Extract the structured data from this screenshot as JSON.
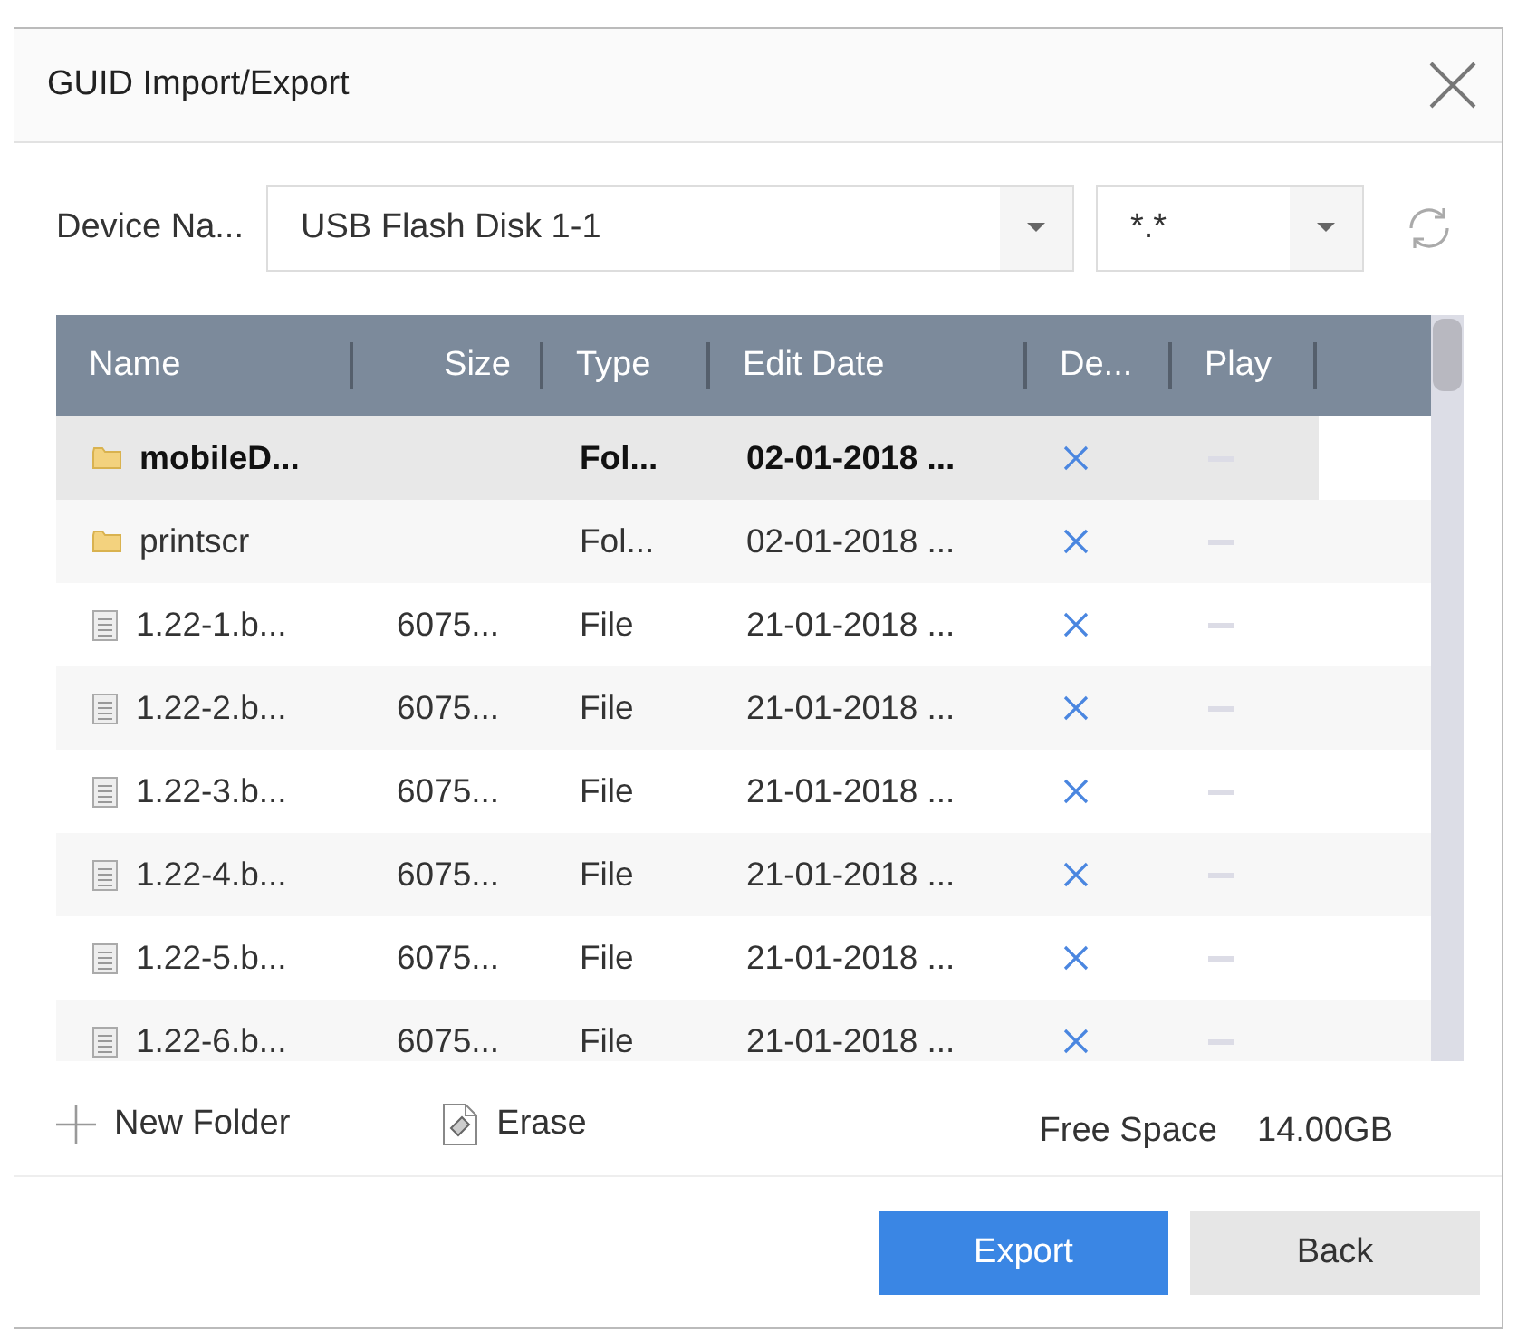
{
  "window": {
    "title": "GUID Import/Export"
  },
  "device": {
    "label": "Device Na...",
    "value": "USB Flash Disk 1-1",
    "filter": "*.*"
  },
  "table": {
    "columns": [
      "Name",
      "Size",
      "Type",
      "Edit Date",
      "De...",
      "Play"
    ],
    "rows": [
      {
        "kind": "folder",
        "name": "mobileD...",
        "size": "",
        "type": "Fol...",
        "date": "02-01-2018 ...",
        "selected": true
      },
      {
        "kind": "folder",
        "name": "printscr",
        "size": "",
        "type": "Fol...",
        "date": "02-01-2018 ...",
        "selected": false
      },
      {
        "kind": "file",
        "name": "1.22-1.b...",
        "size": "6075...",
        "type": "File",
        "date": "21-01-2018 ...",
        "selected": false
      },
      {
        "kind": "file",
        "name": "1.22-2.b...",
        "size": "6075...",
        "type": "File",
        "date": "21-01-2018 ...",
        "selected": false
      },
      {
        "kind": "file",
        "name": "1.22-3.b...",
        "size": "6075...",
        "type": "File",
        "date": "21-01-2018 ...",
        "selected": false
      },
      {
        "kind": "file",
        "name": "1.22-4.b...",
        "size": "6075...",
        "type": "File",
        "date": "21-01-2018 ...",
        "selected": false
      },
      {
        "kind": "file",
        "name": "1.22-5.b...",
        "size": "6075...",
        "type": "File",
        "date": "21-01-2018 ...",
        "selected": false
      },
      {
        "kind": "file",
        "name": "1.22-6.b...",
        "size": "6075...",
        "type": "File",
        "date": "21-01-2018 ...",
        "selected": false
      }
    ]
  },
  "actions": {
    "new_folder": "New Folder",
    "erase": "Erase",
    "free_space_label": "Free Space",
    "free_space_value": "14.00GB"
  },
  "buttons": [
    {
      "kind": "primary",
      "label": "Export"
    },
    {
      "kind": "secondary",
      "label": "Back"
    }
  ]
}
